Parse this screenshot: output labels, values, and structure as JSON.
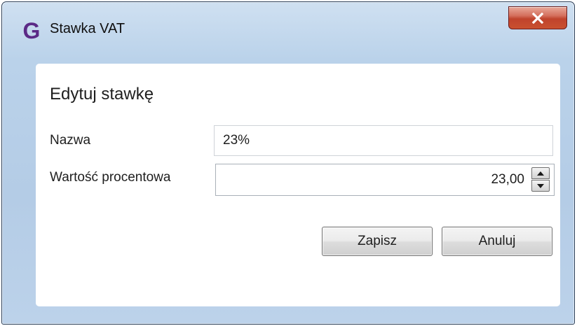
{
  "window": {
    "title": "Stawka VAT",
    "app_icon_letter": "G",
    "close_label": "X"
  },
  "form": {
    "heading": "Edytuj stawkę",
    "name_label": "Nazwa",
    "name_value": "23%",
    "percent_label": "Wartość procentowa",
    "percent_value": "23,00"
  },
  "buttons": {
    "save": "Zapisz",
    "cancel": "Anuluj"
  },
  "colors": {
    "frame": "#b9d1ea",
    "close_button": "#c7432c",
    "app_icon": "#5b2a86"
  }
}
